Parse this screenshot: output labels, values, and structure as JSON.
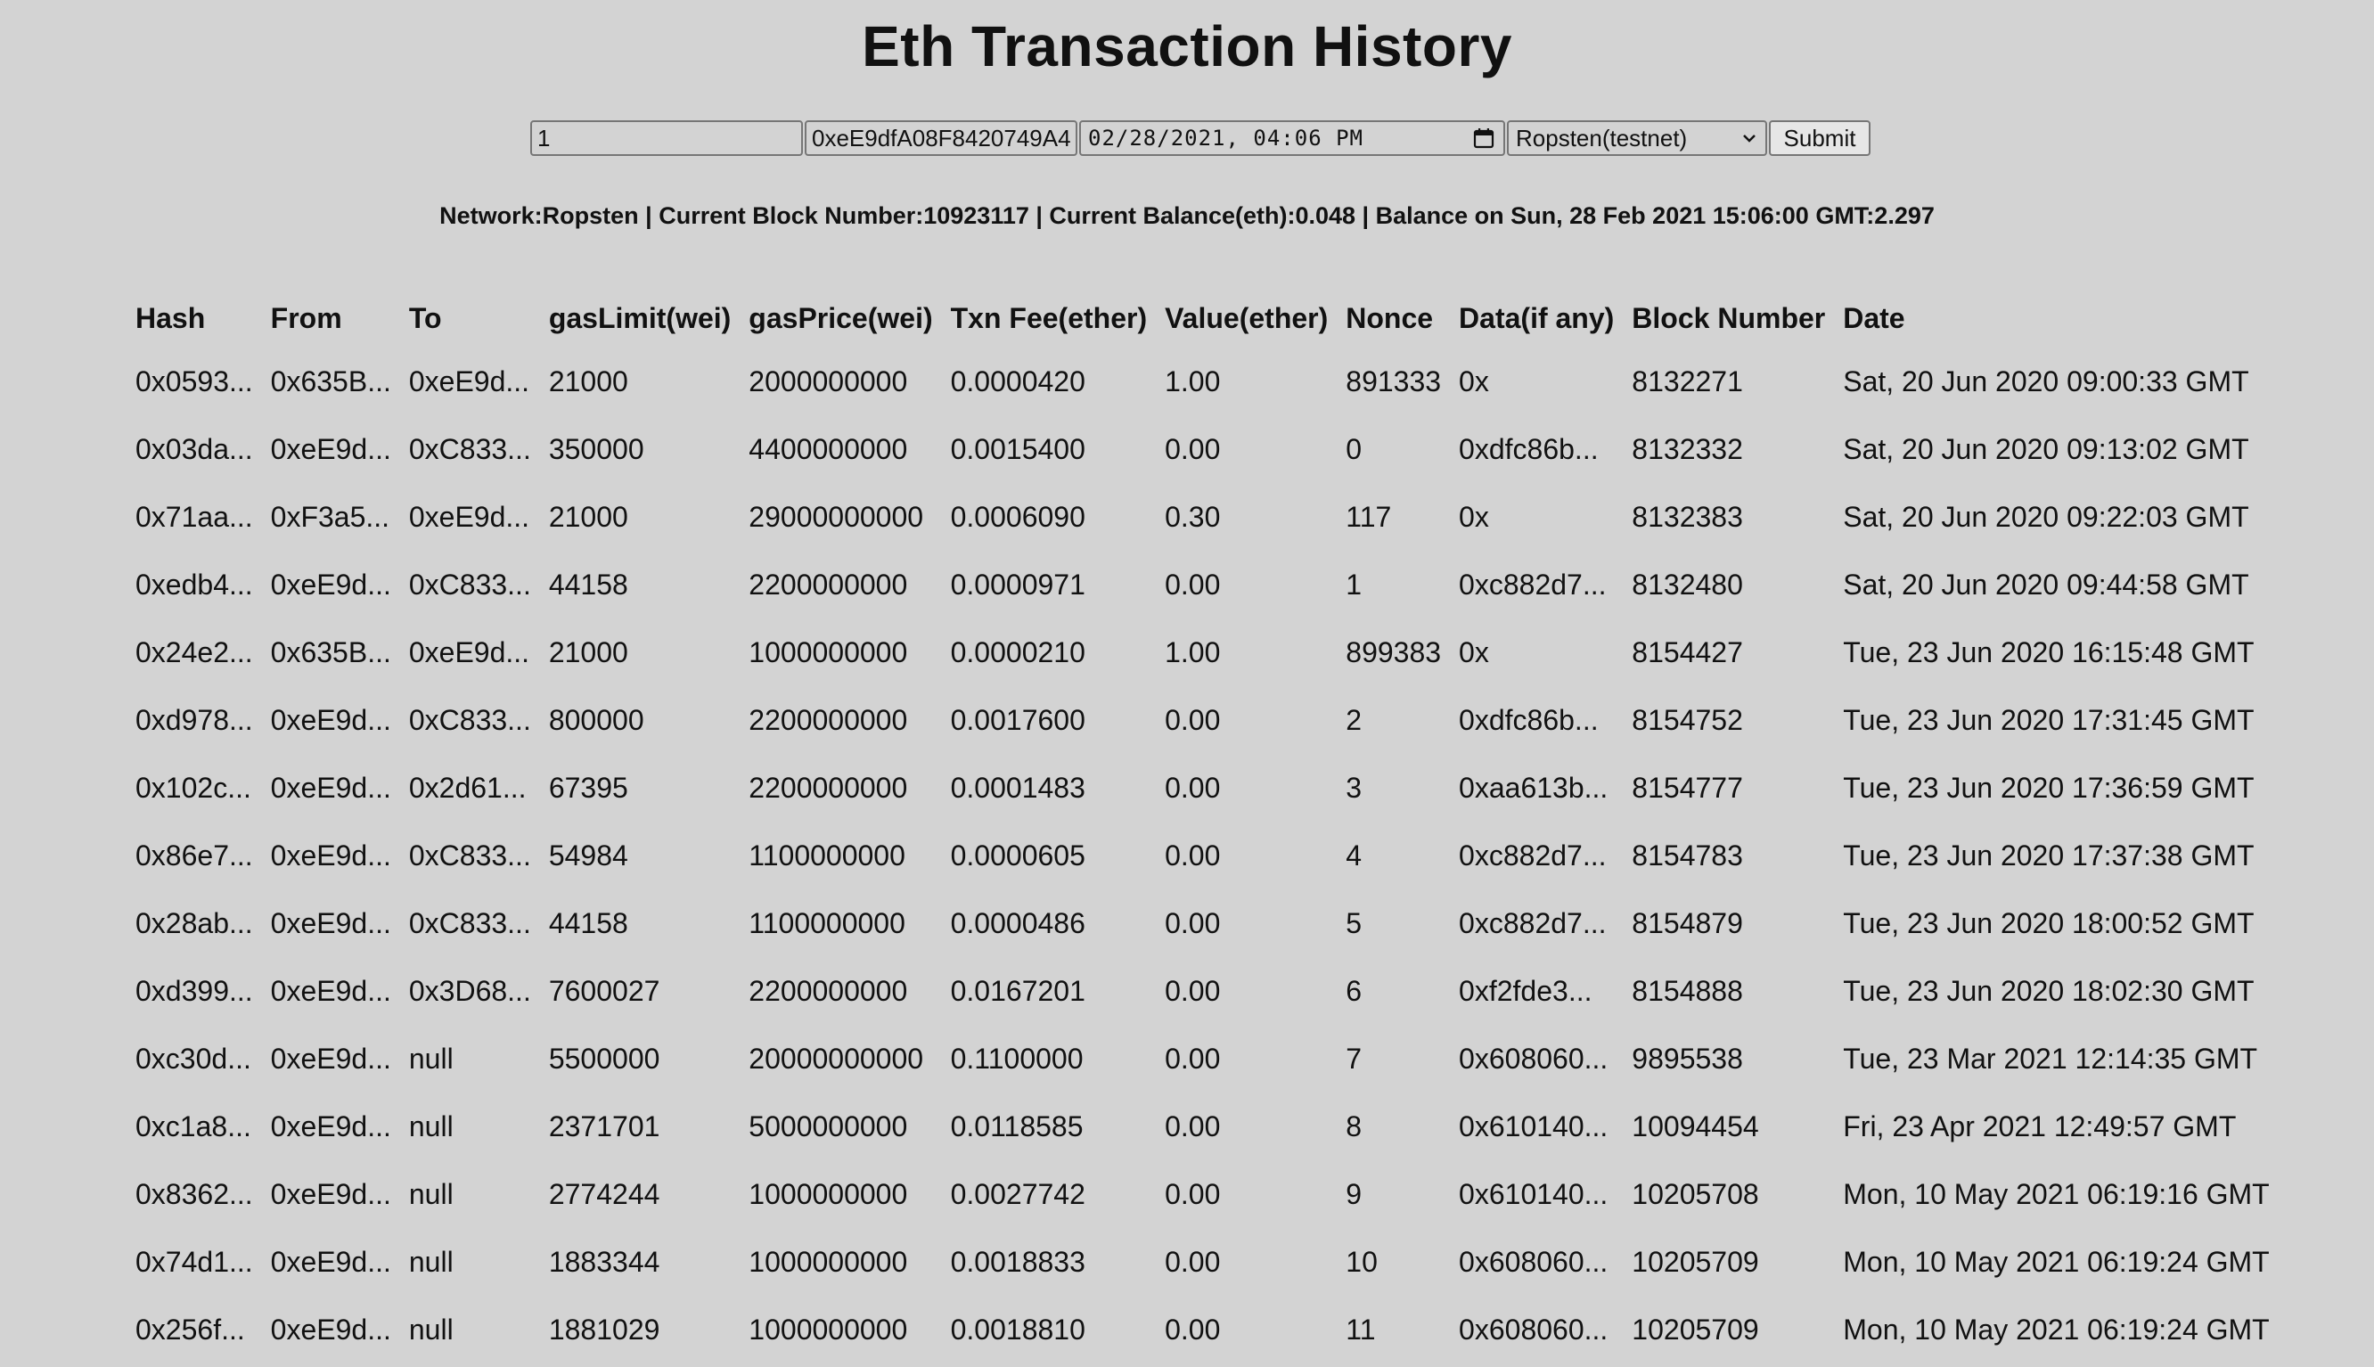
{
  "page": {
    "title": "Eth Transaction History"
  },
  "form": {
    "txn_count_value": "1",
    "address_value": "0xeE9dfA08F8420749A4",
    "date_value": "02/28/2021, 04:06 PM",
    "network_selected": "Ropsten(testnet)",
    "submit_label": "Submit"
  },
  "status": {
    "text": "Network:Ropsten | Current Block Number:10923117 | Current Balance(eth):0.048 | Balance on Sun, 28 Feb 2021 15:06:00 GMT:2.297"
  },
  "table": {
    "headers": [
      "Hash",
      "From",
      "To",
      "gasLimit(wei)",
      "gasPrice(wei)",
      "Txn Fee(ether)",
      "Value(ether)",
      "Nonce",
      "Data(if any)",
      "Block Number",
      "Date"
    ],
    "rows": [
      [
        "0x0593...",
        "0x635B...",
        "0xeE9d...",
        "21000",
        "2000000000",
        "0.0000420",
        "1.00",
        "891333",
        "0x",
        "8132271",
        "Sat, 20 Jun 2020 09:00:33 GMT"
      ],
      [
        "0x03da...",
        "0xeE9d...",
        "0xC833...",
        "350000",
        "4400000000",
        "0.0015400",
        "0.00",
        "0",
        "0xdfc86b...",
        "8132332",
        "Sat, 20 Jun 2020 09:13:02 GMT"
      ],
      [
        "0x71aa...",
        "0xF3a5...",
        "0xeE9d...",
        "21000",
        "29000000000",
        "0.0006090",
        "0.30",
        "117",
        "0x",
        "8132383",
        "Sat, 20 Jun 2020 09:22:03 GMT"
      ],
      [
        "0xedb4...",
        "0xeE9d...",
        "0xC833...",
        "44158",
        "2200000000",
        "0.0000971",
        "0.00",
        "1",
        "0xc882d7...",
        "8132480",
        "Sat, 20 Jun 2020 09:44:58 GMT"
      ],
      [
        "0x24e2...",
        "0x635B...",
        "0xeE9d...",
        "21000",
        "1000000000",
        "0.0000210",
        "1.00",
        "899383",
        "0x",
        "8154427",
        "Tue, 23 Jun 2020 16:15:48 GMT"
      ],
      [
        "0xd978...",
        "0xeE9d...",
        "0xC833...",
        "800000",
        "2200000000",
        "0.0017600",
        "0.00",
        "2",
        "0xdfc86b...",
        "8154752",
        "Tue, 23 Jun 2020 17:31:45 GMT"
      ],
      [
        "0x102c...",
        "0xeE9d...",
        "0x2d61...",
        "67395",
        "2200000000",
        "0.0001483",
        "0.00",
        "3",
        "0xaa613b...",
        "8154777",
        "Tue, 23 Jun 2020 17:36:59 GMT"
      ],
      [
        "0x86e7...",
        "0xeE9d...",
        "0xC833...",
        "54984",
        "1100000000",
        "0.0000605",
        "0.00",
        "4",
        "0xc882d7...",
        "8154783",
        "Tue, 23 Jun 2020 17:37:38 GMT"
      ],
      [
        "0x28ab...",
        "0xeE9d...",
        "0xC833...",
        "44158",
        "1100000000",
        "0.0000486",
        "0.00",
        "5",
        "0xc882d7...",
        "8154879",
        "Tue, 23 Jun 2020 18:00:52 GMT"
      ],
      [
        "0xd399...",
        "0xeE9d...",
        "0x3D68...",
        "7600027",
        "2200000000",
        "0.0167201",
        "0.00",
        "6",
        "0xf2fde3...",
        "8154888",
        "Tue, 23 Jun 2020 18:02:30 GMT"
      ],
      [
        "0xc30d...",
        "0xeE9d...",
        "null",
        "5500000",
        "20000000000",
        "0.1100000",
        "0.00",
        "7",
        "0x608060...",
        "9895538",
        "Tue, 23 Mar 2021 12:14:35 GMT"
      ],
      [
        "0xc1a8...",
        "0xeE9d...",
        "null",
        "2371701",
        "5000000000",
        "0.0118585",
        "0.00",
        "8",
        "0x610140...",
        "10094454",
        "Fri, 23 Apr 2021 12:49:57 GMT"
      ],
      [
        "0x8362...",
        "0xeE9d...",
        "null",
        "2774244",
        "1000000000",
        "0.0027742",
        "0.00",
        "9",
        "0x610140...",
        "10205708",
        "Mon, 10 May 2021 06:19:16 GMT"
      ],
      [
        "0x74d1...",
        "0xeE9d...",
        "null",
        "1883344",
        "1000000000",
        "0.0018833",
        "0.00",
        "10",
        "0x608060...",
        "10205709",
        "Mon, 10 May 2021 06:19:24 GMT"
      ],
      [
        "0x256f...",
        "0xeE9d...",
        "null",
        "1881029",
        "1000000000",
        "0.0018810",
        "0.00",
        "11",
        "0x608060...",
        "10205709",
        "Mon, 10 May 2021 06:19:24 GMT"
      ]
    ]
  }
}
